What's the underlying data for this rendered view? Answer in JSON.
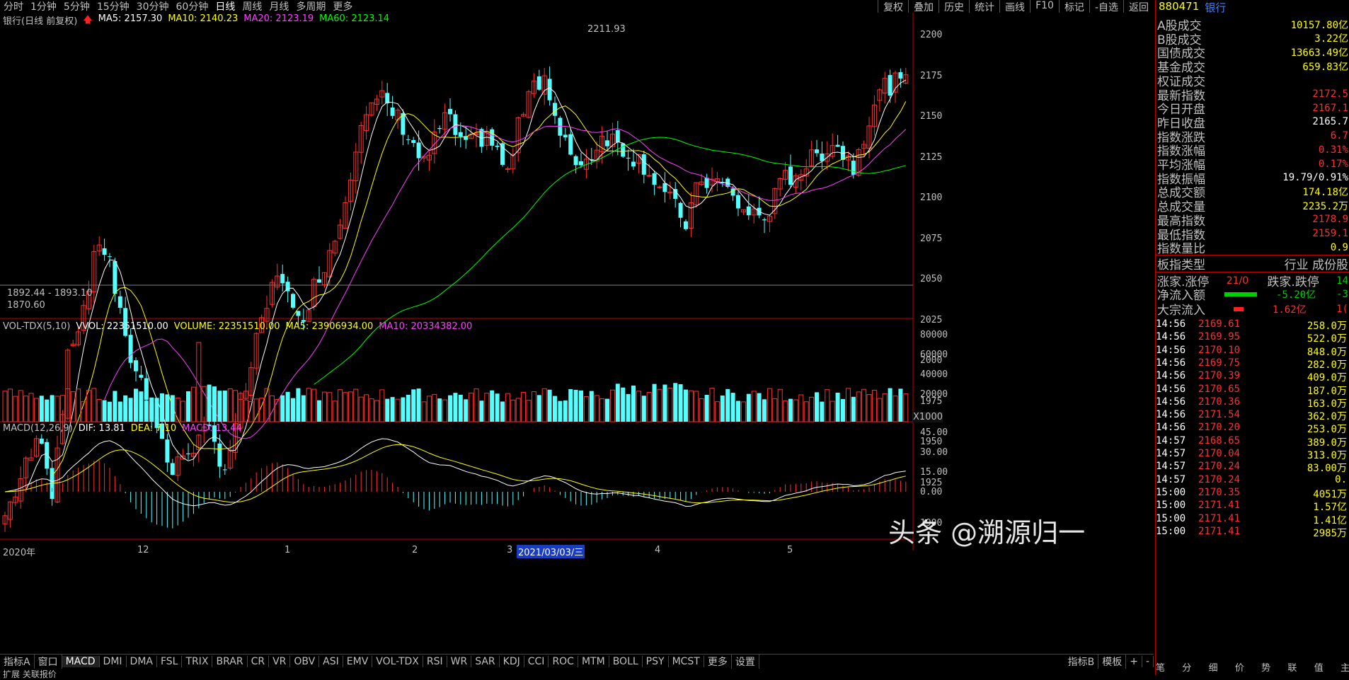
{
  "top_tabs": [
    "分时",
    "1分钟",
    "5分钟",
    "15分钟",
    "30分钟",
    "60分钟",
    "日线",
    "周线",
    "月线",
    "多周期",
    "更多"
  ],
  "top_tools": [
    "复权",
    "叠加",
    "历史",
    "统计",
    "画线",
    "F10",
    "标记",
    "-自选",
    "返回"
  ],
  "main_legend": {
    "name": "银行(日线 前复权)",
    "ma5": "MA5: 2157.30",
    "ma10": "MA10: 2140.23",
    "ma20": "MA20: 2123.19",
    "ma60": "MA60: 2123.14"
  },
  "price_axis": [
    "2200",
    "2175",
    "2150",
    "2125",
    "2100",
    "2075",
    "2050",
    "2025",
    "2000",
    "1975",
    "1950",
    "1925",
    "1900"
  ],
  "annotations": {
    "high": "2211.93",
    "lowpair": "1892.44 - 1893.10",
    "low": "1870.60"
  },
  "vol_legend": {
    "name": "VOL-TDX(5,10)",
    "vvol": "VVOL: 22351510.00",
    "volume": "VOLUME: 22351510.00",
    "ma5": "MA5: 23906934.00",
    "ma10": "MA10: 20334382.00"
  },
  "vol_axis": [
    "80000",
    "60000",
    "40000",
    "20000"
  ],
  "vol_unit": "X1000",
  "macd_legend": {
    "name": "MACD(12,26,9)",
    "dif": "DIF: 13.81",
    "dea": "DEA: 7.10",
    "macd": "MACD: 13.44"
  },
  "macd_axis": [
    "45.00",
    "30.00",
    "15.00",
    "0.00"
  ],
  "time_axis": {
    "year": "2020年",
    "m12": "12",
    "m1": "1",
    "m2": "2",
    "m3": "3",
    "date": "2021/03/03/三",
    "m4": "4",
    "m5": "5"
  },
  "bottom_tabs": [
    "指标A",
    "窗口",
    "MACD",
    "DMI",
    "DMA",
    "FSL",
    "TRIX",
    "BRAR",
    "CR",
    "VR",
    "OBV",
    "ASI",
    "EMV",
    "VOL-TDX",
    "RSI",
    "WR",
    "SAR",
    "KDJ",
    "CCI",
    "ROC",
    "MTM",
    "BOLL",
    "PSY",
    "MCST",
    "更多",
    "设置"
  ],
  "bottom_right_tabs": [
    "指标B",
    "模板",
    "+",
    "-"
  ],
  "status_text": "扩展 关联报价",
  "watermark": "头条 @溯源归一",
  "panel": {
    "code": "880471",
    "name": "银行",
    "quotes": [
      {
        "k": "A股成交",
        "v": "10157.80亿",
        "c": "#ffff00"
      },
      {
        "k": "B股成交",
        "v": "3.22亿",
        "c": "#ffff00"
      },
      {
        "k": "国债成交",
        "v": "13663.49亿",
        "c": "#ffff00"
      },
      {
        "k": "基金成交",
        "v": "659.83亿",
        "c": "#ffff00"
      },
      {
        "k": "权证成交",
        "v": "",
        "c": "#ffff00"
      },
      {
        "k": "最新指数",
        "v": "2172.5",
        "c": "#ff3030"
      },
      {
        "k": "今日开盘",
        "v": "2167.1",
        "c": "#ff3030"
      },
      {
        "k": "昨日收盘",
        "v": "2165.7",
        "c": "#ffffff"
      },
      {
        "k": "指数涨跌",
        "v": "6.7",
        "c": "#ff3030"
      },
      {
        "k": "指数涨幅",
        "v": "0.31%",
        "c": "#ff3030"
      },
      {
        "k": "平均涨幅",
        "v": "0.17%",
        "c": "#ff3030"
      },
      {
        "k": "指数振幅",
        "v": "19.79/0.91%",
        "c": "#ffffff"
      },
      {
        "k": "总成交额",
        "v": "174.18亿",
        "c": "#ffff00"
      },
      {
        "k": "总成交量",
        "v": "2235.2万",
        "c": "#ffff00"
      },
      {
        "k": "最高指数",
        "v": "2178.9",
        "c": "#ff3030"
      },
      {
        "k": "最低指数",
        "v": "2159.1",
        "c": "#ff3030"
      },
      {
        "k": "指数量比",
        "v": "0.9",
        "c": "#ffff00"
      }
    ],
    "type_label": "板指类型",
    "type_value": "行业 成份股",
    "type_value2": "成",
    "updown": {
      "k1": "涨家.涨停",
      "v1": "21/0",
      "k2": "跌家.跌停",
      "v2": "14"
    },
    "flows": [
      {
        "k": "净流入额",
        "v": "-5.20亿",
        "v2": "-3",
        "bar": "#00d000"
      },
      {
        "k": "大宗流入",
        "v": "1.62亿",
        "v2": "1(",
        "bar": "#ff2020"
      }
    ],
    "ticks": [
      [
        "14:56",
        "2169.61",
        "258.0万"
      ],
      [
        "14:56",
        "2169.95",
        "522.0万"
      ],
      [
        "14:56",
        "2170.10",
        "848.0万"
      ],
      [
        "14:56",
        "2169.75",
        "282.0万"
      ],
      [
        "14:56",
        "2170.39",
        "409.0万"
      ],
      [
        "14:56",
        "2170.65",
        "187.0万"
      ],
      [
        "14:56",
        "2170.36",
        "163.0万"
      ],
      [
        "14:56",
        "2171.54",
        "362.0万"
      ],
      [
        "14:56",
        "2170.20",
        "253.0万"
      ],
      [
        "14:57",
        "2168.65",
        "389.0万"
      ],
      [
        "14:57",
        "2170.04",
        "313.0万"
      ],
      [
        "14:57",
        "2170.24",
        "83.00万"
      ],
      [
        "14:57",
        "2170.24",
        "0."
      ],
      [
        "15:00",
        "2170.35",
        "4051万"
      ],
      [
        "15:00",
        "2171.41",
        "1.57亿"
      ],
      [
        "15:00",
        "2171.41",
        "1.41亿"
      ],
      [
        "15:00",
        "2171.41",
        "2985万"
      ]
    ],
    "bottom_tabs": [
      "笔",
      "分",
      "细",
      "价",
      "势",
      "联",
      "值",
      "主"
    ]
  }
}
